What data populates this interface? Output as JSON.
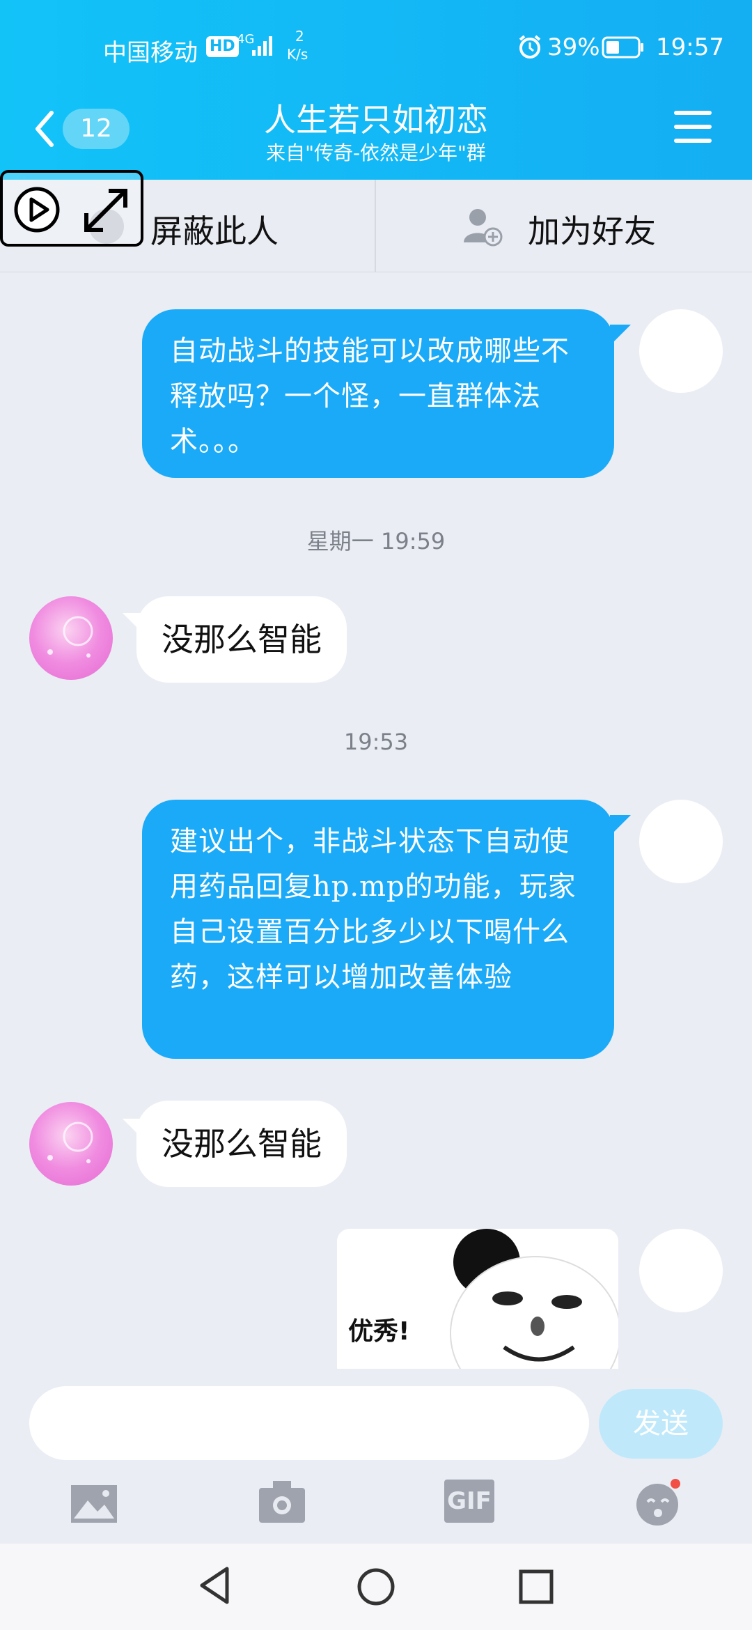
{
  "status_bar": {
    "carrier": "中国移动",
    "hd": "HD",
    "network": "4G",
    "speed_value": "2",
    "speed_unit": "K/s",
    "battery": "39%",
    "time": "19:57"
  },
  "header": {
    "back_count": "12",
    "title": "人生若只如初恋",
    "subtitle": "来自\"传奇-依然是少年\"群"
  },
  "actions": {
    "block_label": "屏蔽此人",
    "add_friend_label": "加为好友"
  },
  "messages": [
    {
      "direction": "out",
      "text": "自动战斗的技能可以改成哪些不释放吗？一个怪，一直群体法术。。。"
    },
    {
      "type": "timestamp",
      "text": "星期一 19:59"
    },
    {
      "direction": "in",
      "text": "没那么智能"
    },
    {
      "type": "timestamp",
      "text": "19:53"
    },
    {
      "direction": "out",
      "text": "建议出个，非战斗状态下自动使用药品回复hp.mp的功能，玩家自己设置百分比多少以下喝什么药，这样可以增加改善体验"
    },
    {
      "direction": "in",
      "text": "没那么智能"
    },
    {
      "direction": "out",
      "type": "sticker",
      "caption": "优秀!"
    }
  ],
  "composer": {
    "input_value": "",
    "send_label": "发送"
  },
  "toolbar": {
    "items": [
      "image-icon",
      "camera-icon",
      "gif-icon",
      "emoji-icon"
    ],
    "gif_label": "GIF"
  },
  "colors": {
    "header": "#14aef3",
    "bubble_out": "#1aaaf8",
    "background": "#eaedf4"
  }
}
